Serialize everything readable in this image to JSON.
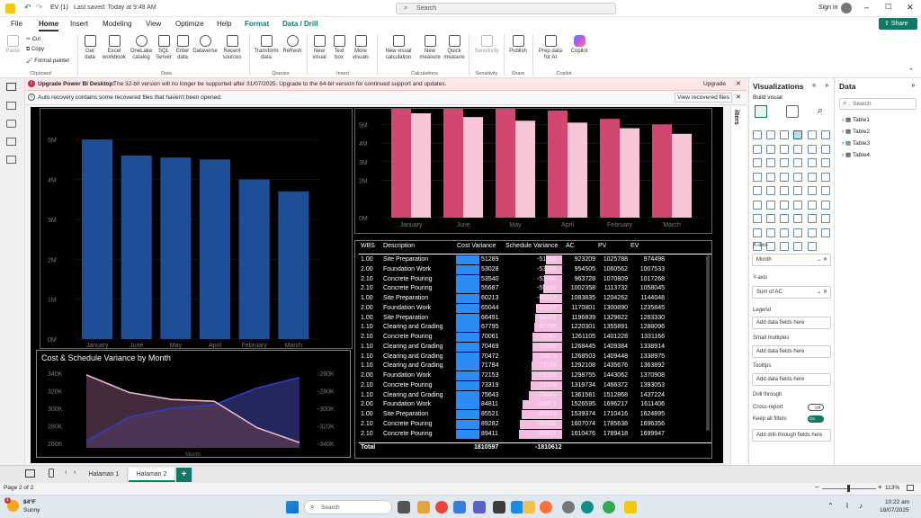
{
  "title_bar": {
    "file_name": "EV (1)",
    "saved": "Last saved: Today at 9:48 AM",
    "search": "Search",
    "sign_in": "Sign in"
  },
  "menu": {
    "items": [
      "File",
      "Home",
      "Insert",
      "Modeling",
      "View",
      "Optimize",
      "Help",
      "Format",
      "Data / Drill"
    ],
    "active": "Home",
    "share": "Share"
  },
  "ribbon": {
    "clipboard": {
      "paste": "Paste",
      "cut": "Cut",
      "copy": "Copy",
      "format_painter": "Format painter",
      "group": "Clipboard"
    },
    "data": {
      "items": [
        "Get data",
        "Excel workbook",
        "OneLake catalog",
        "SQL Server",
        "Enter data",
        "Dataverse",
        "Recent sources"
      ],
      "group": "Data"
    },
    "queries": {
      "items": [
        "Transform data",
        "Refresh"
      ],
      "group": "Queries"
    },
    "insert": {
      "items": [
        "New visual",
        "Text box",
        "More visuals"
      ],
      "group": "Insert"
    },
    "calculations": {
      "items": [
        "New visual calculation",
        "New measure",
        "Quick measure"
      ],
      "group": "Calculations"
    },
    "sensitivity": {
      "items": [
        "Sensitivity"
      ],
      "group": "Sensitivity"
    },
    "share": {
      "items": [
        "Publish"
      ],
      "group": "Share"
    },
    "copilot": {
      "items": [
        "Prep data for AI",
        "Copilot"
      ],
      "group": "Copilot"
    }
  },
  "notices": {
    "warn_bold": "Upgrade Power BI Desktop:",
    "warn_text": "The 32-bit version will no longer be supported after 31/07/2025. Upgrade to the 64-bit version for continued support and updates.",
    "upgrade": "Upgrade",
    "info_text": "Auto recovery contains some recovered files that haven't been opened.",
    "view_recovered": "View recovered files"
  },
  "chart_left_bar": {
    "type": "bar",
    "categories": [
      "January",
      "June",
      "May",
      "April",
      "February",
      "March"
    ],
    "values": [
      5.0,
      4.6,
      4.55,
      4.5,
      4.0,
      3.7
    ],
    "yticks": [
      "5M",
      "4M",
      "3M",
      "2M",
      "1M",
      "0M"
    ],
    "ylim": [
      0,
      5.5
    ],
    "color": "#1e4f96"
  },
  "chart_right_bar": {
    "type": "bar",
    "categories": [
      "January",
      "June",
      "May",
      "April",
      "February",
      "March"
    ],
    "series": [
      {
        "values": [
          6.0,
          5.9,
          5.85,
          5.75,
          5.3,
          5.0
        ],
        "color": "#d2476f"
      },
      {
        "values": [
          5.6,
          5.4,
          5.2,
          5.1,
          4.8,
          4.5
        ],
        "color": "#f6c6d8"
      }
    ],
    "yticks": [
      "5M",
      "4M",
      "3M",
      "2M",
      "1M",
      "0M"
    ],
    "ylim": [
      0,
      5.7
    ]
  },
  "chart_variance": {
    "type": "line",
    "title": "Cost & Schedule Variance by Month",
    "xlabel": "Month",
    "yticks_left": [
      "340K",
      "320K",
      "300K",
      "280K",
      "260K"
    ],
    "yticks_right": [
      "-260K",
      "-280K",
      "-300K",
      "-320K",
      "-340K"
    ],
    "series": [
      {
        "values": [
          263000,
          290000,
          300000,
          304000,
          323000,
          335000
        ],
        "color": "#2c3fc8"
      },
      {
        "values": [
          338000,
          318000,
          310000,
          308000,
          278000,
          261000
        ],
        "color": "#e9b7cd"
      }
    ],
    "ylim": [
      255000,
      345000
    ]
  },
  "table": {
    "headers": [
      "WBS",
      "Description",
      "Cost Variance",
      "Schedule Variance",
      "AC",
      "PV",
      "EV"
    ],
    "rows": [
      [
        "1.00",
        "Site Preparation",
        "51289",
        "-51289",
        "923209",
        "1025788",
        "974498"
      ],
      [
        "2.00",
        "Foundation Work",
        "53028",
        "-53028",
        "954505",
        "1060562",
        "1007533"
      ],
      [
        "2.10",
        "Concrete Pouring",
        "53540",
        "-53540",
        "963728",
        "1070809",
        "1017268"
      ],
      [
        "2.10",
        "Concrete Pouring",
        "55687",
        "-55687",
        "1002358",
        "1113732",
        "1058045"
      ],
      [
        "1.00",
        "Site Preparation",
        "60213",
        "-60213",
        "1083835",
        "1204262",
        "1144048"
      ],
      [
        "2.00",
        "Foundation Work",
        "65044",
        "-65044",
        "1170801",
        "1300890",
        "1235845"
      ],
      [
        "1.00",
        "Site Preparation",
        "66491",
        "-66491",
        "1196839",
        "1329822",
        "1263330"
      ],
      [
        "1.10",
        "Clearing and Grading",
        "67795",
        "-67795",
        "1220301",
        "1355891",
        "1288096"
      ],
      [
        "2.10",
        "Concrete Pouring",
        "70061",
        "-70061",
        "1261105",
        "1401228",
        "1331166"
      ],
      [
        "1.10",
        "Clearing and Grading",
        "70469",
        "-70469",
        "1268445",
        "1409384",
        "1338914"
      ],
      [
        "1.10",
        "Clearing and Grading",
        "70472",
        "-70472",
        "1268503",
        "1409448",
        "1338975"
      ],
      [
        "1.10",
        "Clearing and Grading",
        "71784",
        "-71784",
        "1292108",
        "1435676",
        "1363892"
      ],
      [
        "2.00",
        "Foundation Work",
        "72153",
        "-72153",
        "1298755",
        "1443062",
        "1370908"
      ],
      [
        "2.10",
        "Concrete Pouring",
        "73319",
        "-73319",
        "1319734",
        "1466372",
        "1393053"
      ],
      [
        "1.10",
        "Clearing and Grading",
        "75643",
        "-75643",
        "1361581",
        "1512868",
        "1437224"
      ],
      [
        "2.00",
        "Foundation Work",
        "84811",
        "-84811",
        "1526595",
        "1696217",
        "1611406"
      ],
      [
        "1.00",
        "Site Preparation",
        "85521",
        "-85521",
        "1539374",
        "1710416",
        "1624895"
      ],
      [
        "2.10",
        "Concrete Pouring",
        "89282",
        "-89282",
        "1607074",
        "1785638",
        "1696356"
      ],
      [
        "2.10",
        "Concrete Pouring",
        "89411",
        "-89411",
        "1610476",
        "1789418",
        "1699947"
      ]
    ],
    "total_label": "Total",
    "total_cv": "1810597",
    "total_sv": "-1810612"
  },
  "filters_label": "ilters",
  "viz_panel": {
    "title": "Visualizations",
    "build": "Build visual",
    "xaxis": "X-axis",
    "xaxis_val": "Month",
    "yaxis": "Y-axis",
    "yaxis_val": "Sum of AC",
    "legend": "Legend",
    "small_multiples": "Small multiples",
    "tooltips": "Tooltips",
    "drill": "Drill through",
    "cross_report": "Cross-report",
    "cross_state": "Off",
    "keep_filters": "Keep all filters",
    "keep_state": "On",
    "add_fields": "Add data fields here",
    "add_drill": "Add drill-through fields here"
  },
  "data_panel": {
    "title": "Data",
    "search": "Search",
    "tables": [
      "Table1",
      "Table2",
      "Table3",
      "Table4"
    ]
  },
  "pages": {
    "tabs": [
      "Halaman 1",
      "Halaman 2"
    ],
    "active": "Halaman 2",
    "add": "+"
  },
  "status": {
    "page": "Page 2 of 2",
    "zoom": "113%"
  },
  "taskbar": {
    "temp": "84°F",
    "weather": "Sunny",
    "search": "Search",
    "time": "10:22 am",
    "date": "18/07/2025",
    "badge": "1"
  }
}
